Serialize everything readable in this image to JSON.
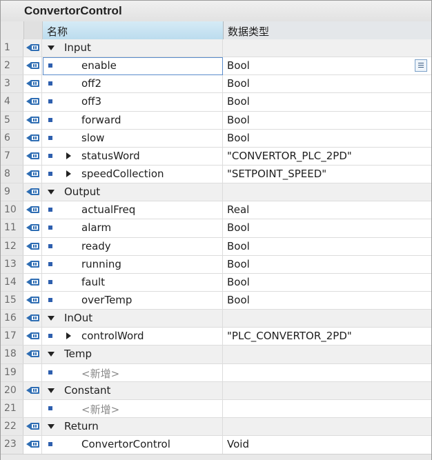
{
  "window": {
    "title": "ConvertorControl"
  },
  "columns": {
    "name": "名称",
    "type": "数据类型"
  },
  "rows": [
    {
      "num": "1",
      "kind": "section",
      "name": "Input",
      "type": ""
    },
    {
      "num": "2",
      "kind": "child-edit",
      "name": "enable",
      "type": "Bool"
    },
    {
      "num": "3",
      "kind": "child",
      "name": "off2",
      "type": "Bool"
    },
    {
      "num": "4",
      "kind": "child",
      "name": "off3",
      "type": "Bool"
    },
    {
      "num": "5",
      "kind": "child",
      "name": "forward",
      "type": "Bool"
    },
    {
      "num": "6",
      "kind": "child",
      "name": "slow",
      "type": "Bool"
    },
    {
      "num": "7",
      "kind": "child-struct",
      "name": "statusWord",
      "type": "\"CONVERTOR_PLC_2PD\""
    },
    {
      "num": "8",
      "kind": "child-struct",
      "name": "speedCollection",
      "type": "\"SETPOINT_SPEED\""
    },
    {
      "num": "9",
      "kind": "section",
      "name": "Output",
      "type": ""
    },
    {
      "num": "10",
      "kind": "child",
      "name": "actualFreq",
      "type": "Real"
    },
    {
      "num": "11",
      "kind": "child",
      "name": "alarm",
      "type": "Bool"
    },
    {
      "num": "12",
      "kind": "child",
      "name": "ready",
      "type": "Bool"
    },
    {
      "num": "13",
      "kind": "child",
      "name": "running",
      "type": "Bool"
    },
    {
      "num": "14",
      "kind": "child",
      "name": "fault",
      "type": "Bool"
    },
    {
      "num": "15",
      "kind": "child",
      "name": "overTemp",
      "type": "Bool"
    },
    {
      "num": "16",
      "kind": "section",
      "name": "InOut",
      "type": ""
    },
    {
      "num": "17",
      "kind": "child-struct",
      "name": "controlWord",
      "type": "\"PLC_CONVERTOR_2PD\""
    },
    {
      "num": "18",
      "kind": "section",
      "name": "Temp",
      "type": ""
    },
    {
      "num": "19",
      "kind": "placeholder",
      "name": "<新增>",
      "type": ""
    },
    {
      "num": "20",
      "kind": "section",
      "name": "Constant",
      "type": ""
    },
    {
      "num": "21",
      "kind": "placeholder",
      "name": "<新增>",
      "type": ""
    },
    {
      "num": "22",
      "kind": "section",
      "name": "Return",
      "type": ""
    },
    {
      "num": "23",
      "kind": "child",
      "name": "ConvertorControl",
      "type": "Void"
    }
  ],
  "colors": {
    "header_selected": "#c8e2f1",
    "interface_icon": "#2e6db3",
    "bullet": "#2e5fae"
  }
}
